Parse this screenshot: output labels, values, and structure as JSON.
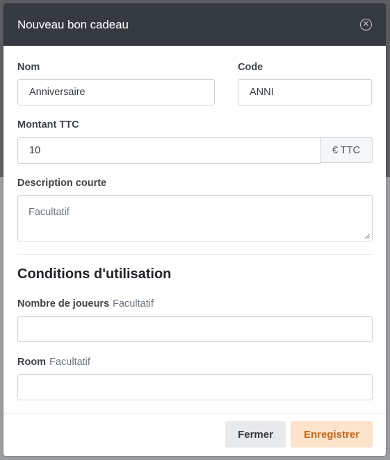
{
  "modal": {
    "title": "Nouveau bon cadeau",
    "close_icon": "close-circle-icon"
  },
  "form": {
    "nom": {
      "label": "Nom",
      "value": "Anniversaire"
    },
    "code": {
      "label": "Code",
      "value": "ANNI"
    },
    "montant": {
      "label": "Montant TTC",
      "value": "10",
      "suffix": "€ TTC"
    },
    "description": {
      "label": "Description courte",
      "placeholder": "Facultatif"
    }
  },
  "conditions": {
    "title": "Conditions d'utilisation",
    "nombre_joueurs": {
      "label": "Nombre de joueurs",
      "hint": "Facultatif",
      "value": ""
    },
    "room": {
      "label": "Room",
      "hint": "Facultatif",
      "value": ""
    }
  },
  "footer": {
    "close_label": "Fermer",
    "save_label": "Enregistrer"
  },
  "colors": {
    "header_bg": "#343a40",
    "save_bg": "#fbe3cc",
    "save_text": "#c8691a"
  }
}
